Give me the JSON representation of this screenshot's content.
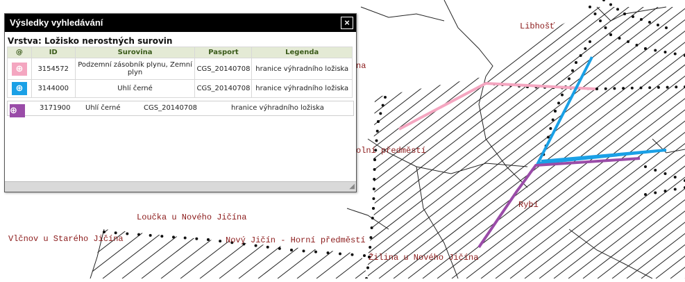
{
  "map": {
    "labels": [
      {
        "name": "label-libhost",
        "text": "Libhošť"
      },
      {
        "name": "label-na",
        "text": "na"
      },
      {
        "name": "label-dolni-predmesti",
        "text": "olní předměstí"
      },
      {
        "name": "label-loucka",
        "text": "Loučka u Nového Jičína"
      },
      {
        "name": "label-vlcnov",
        "text": "Vlčnov u Starého Jičína"
      },
      {
        "name": "label-horni-predmesti",
        "text": "Nový Jičín - Horní předměstí"
      },
      {
        "name": "label-ryby",
        "text": "Rybí"
      },
      {
        "name": "label-zilina",
        "text": "Žilina u Nového Jičína"
      }
    ],
    "label_color": "#8b1a1a",
    "highlight_colors": {
      "pink": "#f4a6c0",
      "blue": "#1aa0e6",
      "purple": "#9a4ca8"
    }
  },
  "panel": {
    "title": "Výsledky vyhledávání",
    "close_symbol": "×",
    "layer_label": "Vrstva: Ložisko nerostných surovin",
    "columns": [
      "@",
      "ID",
      "Surovina",
      "Pasport",
      "Legenda"
    ],
    "rows": [
      {
        "zoom_color": "#f4a6c0",
        "id": "3154572",
        "surovina": "Podzemní zásobník plynu, Zemní plyn",
        "pasport": "CGS_20140708",
        "legenda": "hranice výhradního ložiska"
      },
      {
        "zoom_color": "#1aa0e6",
        "id": "3144000",
        "surovina": "Uhlí černé",
        "pasport": "CGS_20140708",
        "legenda": "hranice výhradního ložiska"
      },
      {
        "zoom_color": "#9a4ca8",
        "id": "3171900",
        "surovina": "Uhlí černé",
        "pasport": "CGS_20140708",
        "legenda": "hranice výhradního ložiska"
      }
    ],
    "zoom_icon": "magnifier-plus-icon"
  }
}
